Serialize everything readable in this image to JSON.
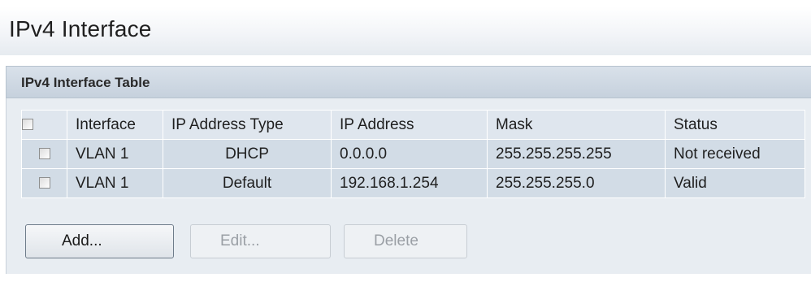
{
  "page": {
    "title": "IPv4 Interface"
  },
  "table": {
    "title": "IPv4 Interface Table",
    "columns": [
      "Interface",
      "IP Address Type",
      "IP Address",
      "Mask",
      "Status"
    ],
    "rows": [
      {
        "interface": "VLAN 1",
        "ip_address_type": "DHCP",
        "ip_address": "0.0.0.0",
        "mask": "255.255.255.255",
        "status": "Not received",
        "checked": false
      },
      {
        "interface": "VLAN 1",
        "ip_address_type": "Default",
        "ip_address": "192.168.1.254",
        "mask": "255.255.255.0",
        "status": "Valid",
        "checked": false
      }
    ],
    "select_all_checked": false
  },
  "buttons": {
    "add": "Add...",
    "edit": "Edit...",
    "delete": "Delete"
  },
  "colors": {
    "header_band": "#c6d1dd",
    "data_row": "#d2dce6",
    "column_header": "#dfe6ee",
    "panel_bg": "#e8edf2",
    "disabled_text": "#9a9fa5"
  }
}
